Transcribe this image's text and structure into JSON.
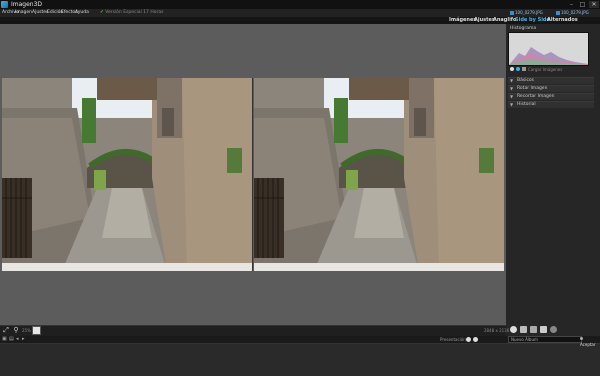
{
  "app": {
    "title": "Imagen3D"
  },
  "window_controls": {
    "minimize": "–",
    "maximize": "□",
    "close": "✕"
  },
  "menu": [
    {
      "label": "Archivo"
    },
    {
      "label": "Imagen"
    },
    {
      "label": "Ajustes"
    },
    {
      "label": "Edición"
    },
    {
      "label": "Efectos"
    },
    {
      "label": "Ayuda"
    }
  ],
  "notice": {
    "icon": "check-icon",
    "text": "Versión Especial 17 Horas"
  },
  "open_files": [
    {
      "label": "100_0279.JPG"
    },
    {
      "label": "100_0279.JPG"
    }
  ],
  "view_tabs": [
    {
      "label": "Imágenes",
      "active": false
    },
    {
      "label": "Ajustes",
      "active": false
    },
    {
      "label": "Anaglifo",
      "active": false
    },
    {
      "label": "Side by Side",
      "active": true
    },
    {
      "label": "Alternados",
      "active": false
    }
  ],
  "histogram": {
    "title": "Histograma",
    "hint": "Cargar Imágenes"
  },
  "panel_sections": [
    {
      "label": "Básicos"
    },
    {
      "label": "Rotar Imagen"
    },
    {
      "label": "Recortar Imagen"
    },
    {
      "label": "Historial"
    }
  ],
  "toolbar": {
    "zoom_label": "25%",
    "coords": "2848 x 2136"
  },
  "bottom": {
    "presentation_label": "Presentación",
    "search_placeholder": "Nuevo Álbum",
    "accept_label": "Aceptar"
  },
  "colors": {
    "accent": "#45b6ea",
    "panel": "#262626",
    "canvas": "#5c5c5c",
    "titlebar": "#111111"
  }
}
